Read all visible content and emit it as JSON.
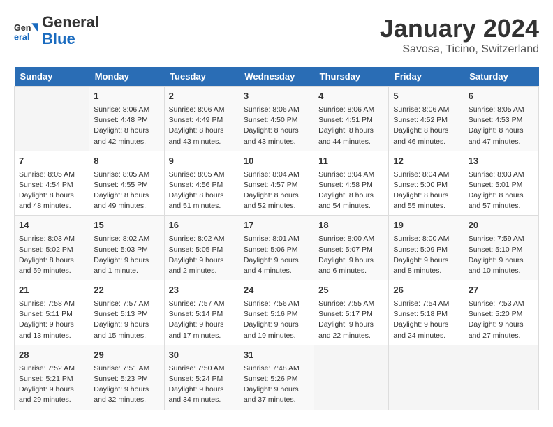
{
  "header": {
    "logo_line1": "General",
    "logo_line2": "Blue",
    "month": "January 2024",
    "location": "Savosa, Ticino, Switzerland"
  },
  "days_of_week": [
    "Sunday",
    "Monday",
    "Tuesday",
    "Wednesday",
    "Thursday",
    "Friday",
    "Saturday"
  ],
  "weeks": [
    [
      {
        "num": "",
        "info": ""
      },
      {
        "num": "1",
        "info": "Sunrise: 8:06 AM\nSunset: 4:48 PM\nDaylight: 8 hours\nand 42 minutes."
      },
      {
        "num": "2",
        "info": "Sunrise: 8:06 AM\nSunset: 4:49 PM\nDaylight: 8 hours\nand 43 minutes."
      },
      {
        "num": "3",
        "info": "Sunrise: 8:06 AM\nSunset: 4:50 PM\nDaylight: 8 hours\nand 43 minutes."
      },
      {
        "num": "4",
        "info": "Sunrise: 8:06 AM\nSunset: 4:51 PM\nDaylight: 8 hours\nand 44 minutes."
      },
      {
        "num": "5",
        "info": "Sunrise: 8:06 AM\nSunset: 4:52 PM\nDaylight: 8 hours\nand 46 minutes."
      },
      {
        "num": "6",
        "info": "Sunrise: 8:05 AM\nSunset: 4:53 PM\nDaylight: 8 hours\nand 47 minutes."
      }
    ],
    [
      {
        "num": "7",
        "info": "Sunrise: 8:05 AM\nSunset: 4:54 PM\nDaylight: 8 hours\nand 48 minutes."
      },
      {
        "num": "8",
        "info": "Sunrise: 8:05 AM\nSunset: 4:55 PM\nDaylight: 8 hours\nand 49 minutes."
      },
      {
        "num": "9",
        "info": "Sunrise: 8:05 AM\nSunset: 4:56 PM\nDaylight: 8 hours\nand 51 minutes."
      },
      {
        "num": "10",
        "info": "Sunrise: 8:04 AM\nSunset: 4:57 PM\nDaylight: 8 hours\nand 52 minutes."
      },
      {
        "num": "11",
        "info": "Sunrise: 8:04 AM\nSunset: 4:58 PM\nDaylight: 8 hours\nand 54 minutes."
      },
      {
        "num": "12",
        "info": "Sunrise: 8:04 AM\nSunset: 5:00 PM\nDaylight: 8 hours\nand 55 minutes."
      },
      {
        "num": "13",
        "info": "Sunrise: 8:03 AM\nSunset: 5:01 PM\nDaylight: 8 hours\nand 57 minutes."
      }
    ],
    [
      {
        "num": "14",
        "info": "Sunrise: 8:03 AM\nSunset: 5:02 PM\nDaylight: 8 hours\nand 59 minutes."
      },
      {
        "num": "15",
        "info": "Sunrise: 8:02 AM\nSunset: 5:03 PM\nDaylight: 9 hours\nand 1 minute."
      },
      {
        "num": "16",
        "info": "Sunrise: 8:02 AM\nSunset: 5:05 PM\nDaylight: 9 hours\nand 2 minutes."
      },
      {
        "num": "17",
        "info": "Sunrise: 8:01 AM\nSunset: 5:06 PM\nDaylight: 9 hours\nand 4 minutes."
      },
      {
        "num": "18",
        "info": "Sunrise: 8:00 AM\nSunset: 5:07 PM\nDaylight: 9 hours\nand 6 minutes."
      },
      {
        "num": "19",
        "info": "Sunrise: 8:00 AM\nSunset: 5:09 PM\nDaylight: 9 hours\nand 8 minutes."
      },
      {
        "num": "20",
        "info": "Sunrise: 7:59 AM\nSunset: 5:10 PM\nDaylight: 9 hours\nand 10 minutes."
      }
    ],
    [
      {
        "num": "21",
        "info": "Sunrise: 7:58 AM\nSunset: 5:11 PM\nDaylight: 9 hours\nand 13 minutes."
      },
      {
        "num": "22",
        "info": "Sunrise: 7:57 AM\nSunset: 5:13 PM\nDaylight: 9 hours\nand 15 minutes."
      },
      {
        "num": "23",
        "info": "Sunrise: 7:57 AM\nSunset: 5:14 PM\nDaylight: 9 hours\nand 17 minutes."
      },
      {
        "num": "24",
        "info": "Sunrise: 7:56 AM\nSunset: 5:16 PM\nDaylight: 9 hours\nand 19 minutes."
      },
      {
        "num": "25",
        "info": "Sunrise: 7:55 AM\nSunset: 5:17 PM\nDaylight: 9 hours\nand 22 minutes."
      },
      {
        "num": "26",
        "info": "Sunrise: 7:54 AM\nSunset: 5:18 PM\nDaylight: 9 hours\nand 24 minutes."
      },
      {
        "num": "27",
        "info": "Sunrise: 7:53 AM\nSunset: 5:20 PM\nDaylight: 9 hours\nand 27 minutes."
      }
    ],
    [
      {
        "num": "28",
        "info": "Sunrise: 7:52 AM\nSunset: 5:21 PM\nDaylight: 9 hours\nand 29 minutes."
      },
      {
        "num": "29",
        "info": "Sunrise: 7:51 AM\nSunset: 5:23 PM\nDaylight: 9 hours\nand 32 minutes."
      },
      {
        "num": "30",
        "info": "Sunrise: 7:50 AM\nSunset: 5:24 PM\nDaylight: 9 hours\nand 34 minutes."
      },
      {
        "num": "31",
        "info": "Sunrise: 7:48 AM\nSunset: 5:26 PM\nDaylight: 9 hours\nand 37 minutes."
      },
      {
        "num": "",
        "info": ""
      },
      {
        "num": "",
        "info": ""
      },
      {
        "num": "",
        "info": ""
      }
    ]
  ]
}
